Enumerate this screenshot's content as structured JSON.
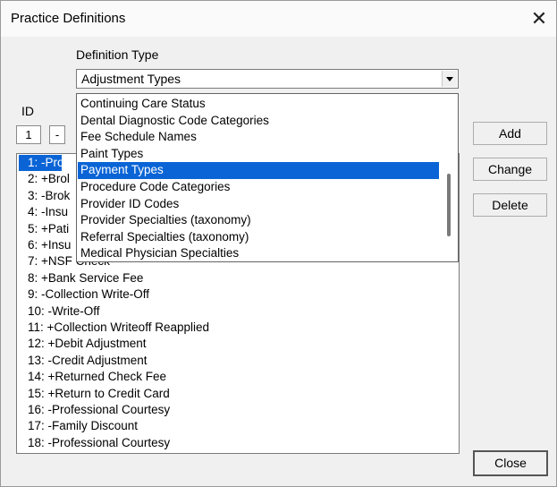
{
  "window": {
    "title": "Practice Definitions",
    "close_glyph": "✕"
  },
  "definition_type": {
    "label": "Definition Type",
    "selected": "Adjustment Types",
    "options": [
      "Continuing Care Status",
      "Dental Diagnostic Code Categories",
      "Fee Schedule Names",
      "Paint Types",
      "Payment Types",
      "Procedure Code Categories",
      "Provider ID Codes",
      "Provider Specialties (taxonomy)",
      "Referral Specialties (taxonomy)",
      "Medical Physician Specialties"
    ],
    "highlighted_index": 4
  },
  "id_section": {
    "label": "ID",
    "value": "1",
    "sign": "-"
  },
  "definitions": {
    "items": [
      "1: -Profe",
      "2: +Brol",
      "3: -Brok",
      "4: -Insu",
      "5: +Pati",
      "6: +Insu",
      "7: +NSF Check",
      "8: +Bank Service Fee",
      "9: -Collection Write-Off",
      "10: -Write-Off",
      "11: +Collection Writeoff Reapplied",
      "12: +Debit Adjustment",
      "13: -Credit Adjustment",
      "14: +Returned Check Fee",
      "15: +Return to Credit Card",
      "16: -Professional Courtesy",
      "17: -Family Discount",
      "18: -Professional Courtesy"
    ],
    "selected_index": 0
  },
  "buttons": {
    "add": "Add",
    "change": "Change",
    "delete": "Delete",
    "close": "Close"
  }
}
